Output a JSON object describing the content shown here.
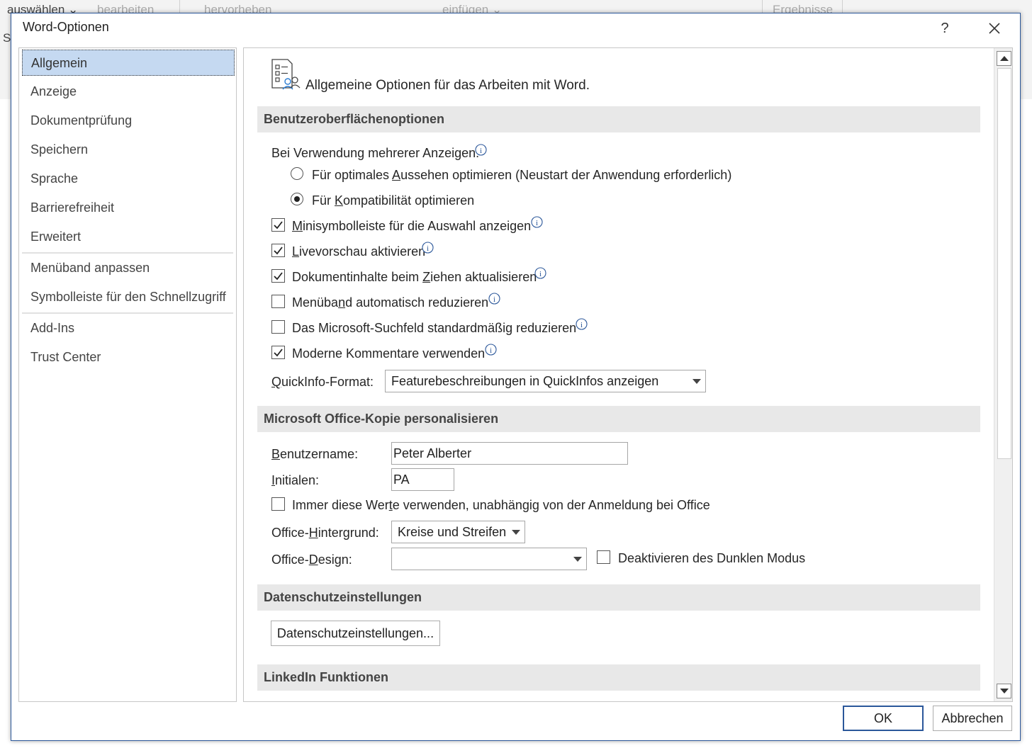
{
  "background": {
    "frag1": "auswählen ⌄",
    "frag2": "bearbeiten",
    "frag3": "hervorheben",
    "frag4": "einfügen ⌄",
    "frag5": "Ergebnisse",
    "frag6": "S"
  },
  "dialog": {
    "title": "Word-Optionen",
    "help": "?"
  },
  "sidebar": {
    "items": [
      {
        "label": "Allgemein"
      },
      {
        "label": "Anzeige"
      },
      {
        "label": "Dokumentprüfung"
      },
      {
        "label": "Speichern"
      },
      {
        "label": "Sprache"
      },
      {
        "label": "Barrierefreiheit"
      },
      {
        "label": "Erweitert"
      },
      {
        "label": "Menüband anpassen"
      },
      {
        "label": "Symbolleiste für den Schnellzugriff"
      },
      {
        "label": "Add-Ins"
      },
      {
        "label": "Trust Center"
      }
    ]
  },
  "main": {
    "header": "Allgemeine Optionen für das Arbeiten mit Word.",
    "sections": {
      "ui": "Benutzeroberflächenoptionen",
      "personalize": "Microsoft Office-Kopie personalisieren",
      "privacy": "Datenschutzeinstellungen",
      "linkedin": "LinkedIn Funktionen"
    },
    "multi_display_label": "Bei Verwendung mehrerer Anzeigen:",
    "radio_optimal": {
      "pre": "Für optimales ",
      "u": "A",
      "post": "ussehen optimieren (Neustart der Anwendung erforderlich)",
      "checked": false
    },
    "radio_compat": {
      "pre": "Für ",
      "u": "K",
      "post": "ompatibilität optimieren",
      "checked": true
    },
    "cb_mini": {
      "pre": "",
      "u": "M",
      "post": "inisymbolleiste für die Auswahl anzeigen",
      "checked": true
    },
    "cb_live": {
      "pre": "",
      "u": "L",
      "post": "ivevorschau aktivieren",
      "checked": true
    },
    "cb_drag": {
      "pre": "Dokumentinhalte beim ",
      "u": "Z",
      "post": "iehen aktualisieren",
      "checked": true
    },
    "cb_ribbon": {
      "pre": "Menüba",
      "u": "n",
      "post": "d automatisch reduzieren",
      "checked": false
    },
    "cb_search": {
      "pre": "Das Microsoft-Suchfeld standardmäßig reduzieren",
      "u": "",
      "post": "",
      "checked": false
    },
    "cb_comments": {
      "pre": "Moderne Kommentare verwenden",
      "u": "",
      "post": "",
      "checked": true
    },
    "quickinfo": {
      "label_u": "Q",
      "label_rest": "uickInfo-Format:",
      "value": "Featurebeschreibungen in QuickInfos anzeigen"
    },
    "username": {
      "label_u": "B",
      "label_rest": "enutzername:",
      "value": "Peter Alberter"
    },
    "initials": {
      "label_u": "I",
      "label_rest": "nitialen:",
      "value": "PA"
    },
    "cb_always": {
      "pre": "Immer diese Wer",
      "u": "t",
      "post": "e verwenden, unabhängig von der Anmeldung bei Office",
      "checked": false
    },
    "background_sel": {
      "label_pre": "Office-",
      "label_u": "H",
      "label_rest": "intergrund:",
      "value": "Kreise und Streifen"
    },
    "design_sel": {
      "label_pre": "Office-",
      "label_u": "D",
      "label_rest": "esign:",
      "value": ""
    },
    "cb_dark": {
      "pre": "Deaktivieren des Dunklen Modus",
      "u": "",
      "post": "",
      "checked": false
    },
    "privacy_button": "Datenschutzeinstellungen..."
  },
  "footer": {
    "ok": "OK",
    "cancel": "Abbrechen"
  },
  "colors": {
    "accent": "#2b579a",
    "selected_bg": "#c5d9f1",
    "section_bg": "#e8e8e8"
  }
}
